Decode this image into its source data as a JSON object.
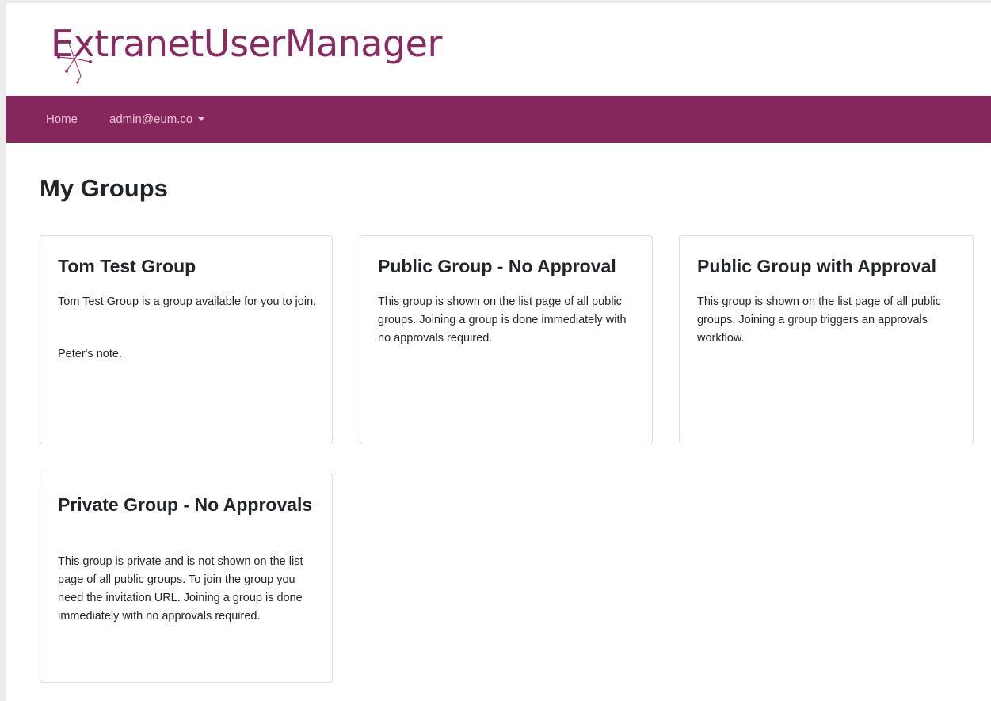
{
  "brand": {
    "name": "ExtranetUserManager",
    "colors": {
      "primary": "#85265c",
      "logo": "#8a2a63",
      "nav_text": "#e5c4d6"
    }
  },
  "navbar": {
    "items": [
      {
        "label": "Home"
      },
      {
        "label": "admin@eum.co",
        "has_dropdown": true,
        "icon": "caret-down-icon"
      }
    ]
  },
  "page": {
    "title": "My Groups"
  },
  "groups": [
    {
      "title": "Tom Test Group",
      "description": "Tom Test Group is a group available for you to join.",
      "note": "Peter's note."
    },
    {
      "title": "Public Group - No Approval",
      "description": "This group is shown on the list page of all public groups.  Joining a group is done immediately with no approvals required."
    },
    {
      "title": "Public Group with Approval",
      "description": "This group is shown on the list page of all public groups.  Joining a group triggers an approvals workflow."
    },
    {
      "title": "Private Group - No Approvals",
      "description": "This group is private and is not shown on the list page of all public groups.  To join the group you need the invitation URL. Joining a group is done immediately with no approvals required."
    }
  ]
}
